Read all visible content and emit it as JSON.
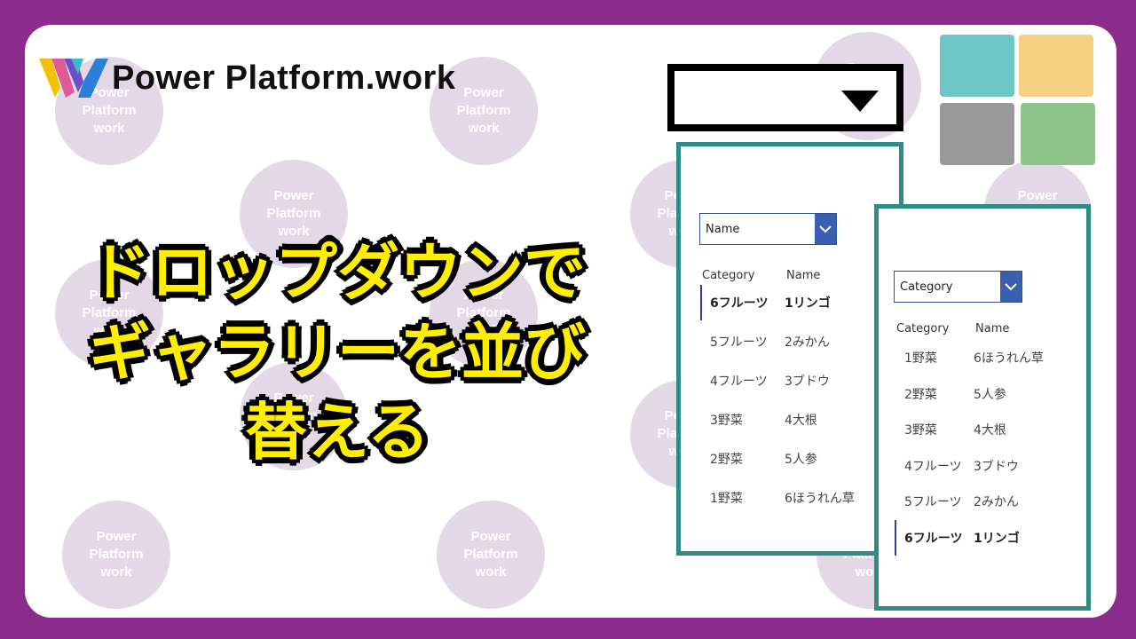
{
  "logo": {
    "text": "Power Platform.work"
  },
  "watermark": {
    "text": "Power\nPlatform\nwork"
  },
  "headline": {
    "line1": "ドロップダウンで",
    "line2": "ギャラリーを並び",
    "line3": "替える"
  },
  "colors": {
    "background": "#8b2c8c",
    "headline_fill": "#ffee00",
    "headline_stroke": "#e0151a",
    "card_border": "#2e8b86",
    "dropdown_button": "#3a5fb0",
    "tiles": [
      "#6cc6c6",
      "#f5d080",
      "#999999",
      "#8ec48a"
    ]
  },
  "gallery1": {
    "dropdown_value": "Name",
    "header_category": "Category",
    "header_name": "Name",
    "rows": [
      {
        "category": "6フルーツ",
        "name": "1リンゴ",
        "selected": true
      },
      {
        "category": "5フルーツ",
        "name": "2みかん",
        "selected": false
      },
      {
        "category": "4フルーツ",
        "name": "3ブドウ",
        "selected": false
      },
      {
        "category": "3野菜",
        "name": "4大根",
        "selected": false
      },
      {
        "category": "2野菜",
        "name": "5人参",
        "selected": false
      },
      {
        "category": "1野菜",
        "name": "6ほうれん草",
        "selected": false
      }
    ]
  },
  "gallery2": {
    "dropdown_value": "Category",
    "header_category": "Category",
    "header_name": "Name",
    "rows": [
      {
        "category": "1野菜",
        "name": "6ほうれん草",
        "selected": false
      },
      {
        "category": "2野菜",
        "name": "5人参",
        "selected": false
      },
      {
        "category": "3野菜",
        "name": "4大根",
        "selected": false
      },
      {
        "category": "4フルーツ",
        "name": "3ブドウ",
        "selected": false
      },
      {
        "category": "5フルーツ",
        "name": "2みかん",
        "selected": false
      },
      {
        "category": "6フルーツ",
        "name": "1リンゴ",
        "selected": true
      }
    ]
  }
}
